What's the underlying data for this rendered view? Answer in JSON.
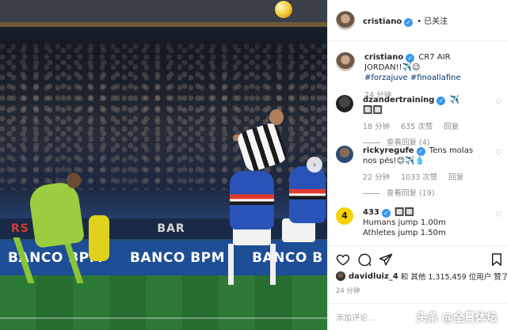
{
  "header": {
    "username": "cristiano",
    "follow_status": "已关注"
  },
  "caption": {
    "username": "cristiano",
    "text": "CR7 AIR JORDAN!!✈️😉",
    "hashtags": "#forzajuve #finoallafine",
    "time": "24 分钟"
  },
  "comments": [
    {
      "username": "dzandertraining",
      "text": "✈️ 🔲🔲",
      "time": "18 分钟",
      "likes": "635 次赞",
      "reply": "回复",
      "view_replies": "查看回复 (4)"
    },
    {
      "username": "rickyregufe",
      "text": "Tens molas nos pés!😊✈️💧",
      "time": "22 分钟",
      "likes": "1033 次赞",
      "reply": "回复",
      "view_replies": "查看回复 (19)"
    },
    {
      "username": "433",
      "avatar_text": "4",
      "text_line1": "🔲🔲",
      "text_line2": "Humans jump 1.00m",
      "text_line3": "Athletes jump 1.50m"
    }
  ],
  "likes_line": {
    "user": "davidluiz_4",
    "text": "和 其他 1,315,459 位用户 赞了"
  },
  "post_time": "24 分钟",
  "add_comment_placeholder": "添加评论...",
  "watermark": "头条 @全景体坛",
  "photo": {
    "ad_text_1": "RS ANTE",
    "ad_text_2": "BAR",
    "banner_1": "BANCO BPM",
    "banner_2": "BANCO BPM",
    "banner_3": "BANCO B"
  },
  "icons": [
    "heart-icon",
    "comment-icon",
    "share-icon",
    "bookmark-icon",
    "verified-icon",
    "next-photo-icon"
  ],
  "colors": {
    "verified": "#3897f0",
    "link": "#003569",
    "muted": "#8e8e8e"
  }
}
